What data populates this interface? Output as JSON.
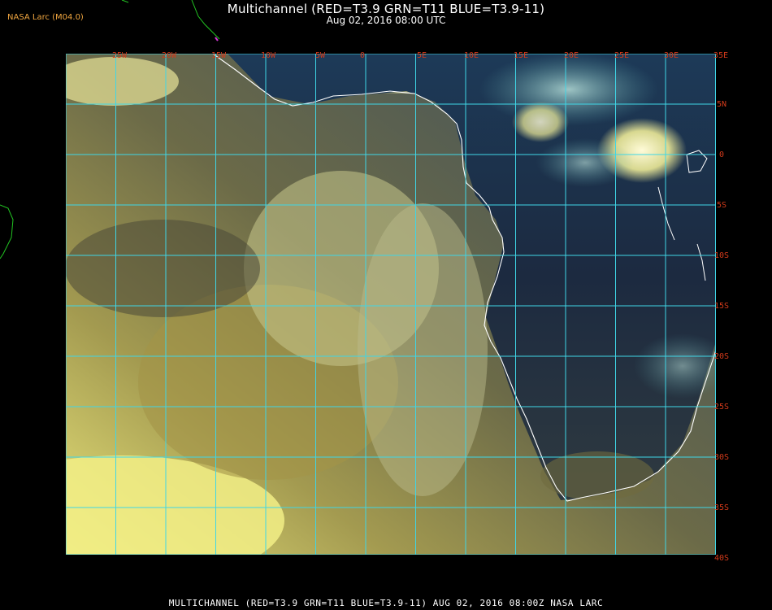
{
  "header": {
    "title": "Multichannel (RED=T3.9 GRN=T11 BLUE=T3.9-11)",
    "timestamp": "Aug 02, 2016 08:00 UTC"
  },
  "badge": "NASA Larc (M04.0)",
  "footer": "MULTICHANNEL (RED=T3.9 GRN=T11 BLUE=T3.9-11) AUG 02, 2016 08:00Z  NASA LARC",
  "map": {
    "longitude_labels": [
      "25W",
      "20W",
      "15W",
      "10W",
      "5W",
      "0",
      "5E",
      "10E",
      "15E",
      "20E",
      "25E",
      "30E",
      "35E"
    ],
    "latitude_labels": [
      "5N",
      "0",
      "5S",
      "10S",
      "15S",
      "20S",
      "25S",
      "30S",
      "35S",
      "40S"
    ],
    "colors": {
      "grid": "#3fd6e6",
      "coastline": "#ffffff",
      "labels": "#d33a1a",
      "ocean_clouds": "#b8b455",
      "land": "#243048"
    }
  }
}
